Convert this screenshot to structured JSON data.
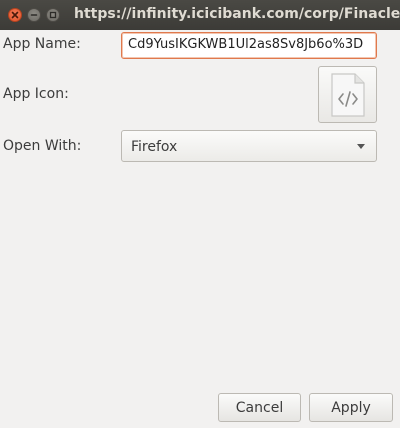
{
  "window": {
    "title": "https://infinity.icicibank.com/corp/Finacle;jse"
  },
  "form": {
    "app_name_label": "App Name:",
    "app_name_value": "Cd9YusIKGKWB1Ul2as8Sv8Jb6o%3D",
    "app_icon_label": "App Icon:",
    "app_icon": "code-file-icon",
    "open_with_label": "Open With:",
    "open_with_value": "Firefox"
  },
  "buttons": {
    "cancel_label": "Cancel",
    "apply_label": "Apply"
  },
  "colors": {
    "titlebar": "#3c3b37",
    "close_button": "#e0532a",
    "focus_border": "#e0794d",
    "background": "#f2f1f0"
  }
}
